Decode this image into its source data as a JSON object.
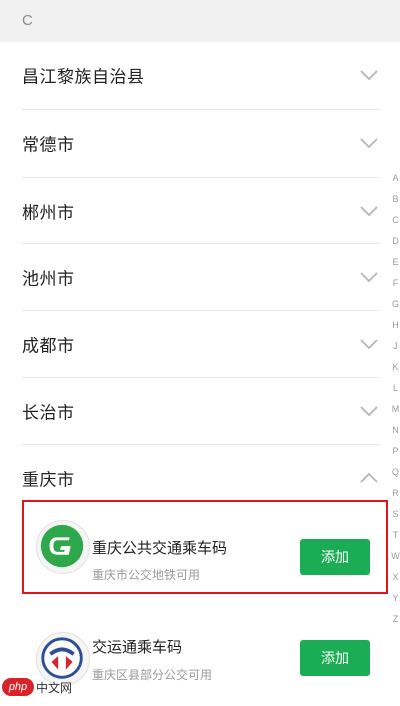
{
  "section": {
    "letter": "C"
  },
  "cities": [
    {
      "name": "昌江黎族自治县",
      "expanded": false
    },
    {
      "name": "常德市",
      "expanded": false
    },
    {
      "name": "郴州市",
      "expanded": false
    },
    {
      "name": "池州市",
      "expanded": false
    },
    {
      "name": "成都市",
      "expanded": false
    },
    {
      "name": "长治市",
      "expanded": false
    },
    {
      "name": "重庆市",
      "expanded": true
    }
  ],
  "cards": [
    {
      "title": "重庆公共交通乘车码",
      "subtitle": "重庆市公交地铁可用",
      "button_label": "添加",
      "icon": "chongqing-transit-logo",
      "highlighted": true
    },
    {
      "title": "交运通乘车码",
      "subtitle": "重庆区县部分公交可用",
      "button_label": "添加",
      "icon": "jiaoyuntong-logo",
      "highlighted": false
    }
  ],
  "index_bar": [
    "A",
    "B",
    "C",
    "D",
    "E",
    "F",
    "G",
    "H",
    "J",
    "K",
    "L",
    "M",
    "N",
    "P",
    "Q",
    "R",
    "S",
    "T",
    "W",
    "X",
    "Y",
    "Z"
  ],
  "watermark": {
    "badge": "php",
    "text": "中文网"
  },
  "colors": {
    "accent_green": "#1aad55",
    "highlight_red": "#e0161c"
  }
}
